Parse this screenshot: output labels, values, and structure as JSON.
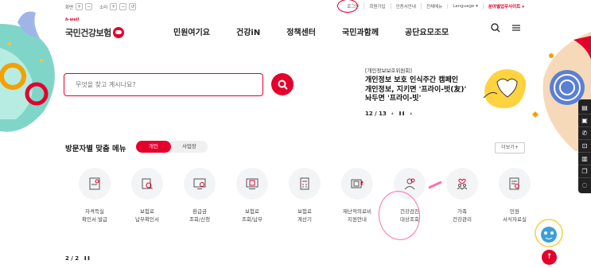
{
  "utility_left": {
    "screen_label": "화면",
    "sound_label": "소리",
    "plus": "+",
    "minus": "−",
    "reset": "↺"
  },
  "utility_right": [
    "로그인",
    "회원가입",
    "인증서안내",
    "전체메뉴",
    "Language ▾",
    "분야별업무사이트 ▾"
  ],
  "logo": {
    "tagline": "h-well",
    "name": "국민건강보험"
  },
  "gnb": [
    "민원여기요",
    "건강iN",
    "정책센터",
    "국민과함께",
    "공단요모조모"
  ],
  "search": {
    "placeholder": "무엇을 찾고 계시나요?"
  },
  "promo": {
    "category": "[개인정보보호위원회]",
    "title": "개인정보 보호 인식주간 캠페인\n개인정보, 지키면 '프라이-벗(友)'\n놔두면 '프라이-빗'",
    "pager": "12 / 13",
    "prev": "‹",
    "pause": "❚❚",
    "next": "›"
  },
  "section": {
    "title": "방문자별 맞춤 메뉴",
    "tab_personal": "개인",
    "tab_business": "사업장",
    "more": "더보기+"
  },
  "quick_menu": [
    {
      "label": "자격득실\n확인서 발급",
      "icon": "certificate-icon"
    },
    {
      "label": "보험료\n납부확인서",
      "icon": "receipt-search-icon"
    },
    {
      "label": "환급금\n조회/신청",
      "icon": "monitor-refund-icon"
    },
    {
      "label": "보험료\n조회/납부",
      "icon": "payment-screen-icon"
    },
    {
      "label": "보험료\n계산기",
      "icon": "calculator-icon"
    },
    {
      "label": "재난적의료비\n지원안내",
      "icon": "medical-support-icon"
    },
    {
      "label": "건강검진\n대상조회",
      "icon": "health-checkup-icon"
    },
    {
      "label": "가족\n건강관리",
      "icon": "family-care-icon"
    },
    {
      "label": "민원\n서식자료실",
      "icon": "form-library-icon"
    }
  ],
  "bottom_pager": {
    "text": "2 / 2",
    "pause": "❚❚"
  },
  "top_button": "↑",
  "colors": {
    "brand": "#e4002b",
    "annotation_pink": "#ff6fae"
  }
}
